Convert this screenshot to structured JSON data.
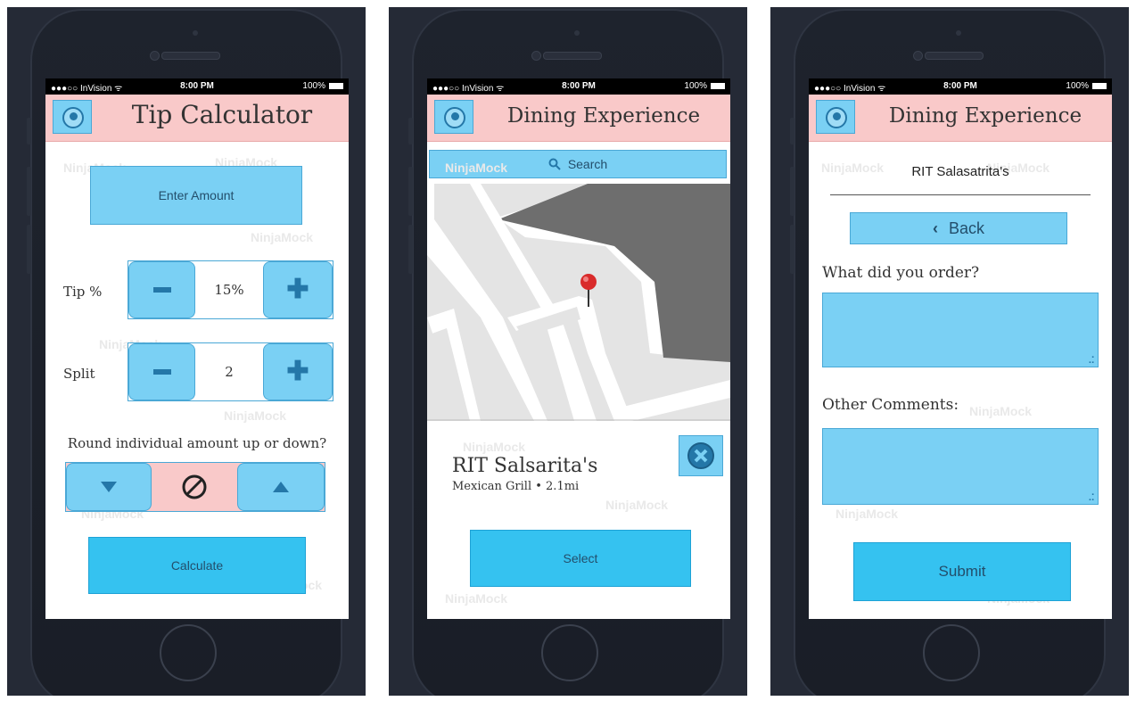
{
  "status_bar": {
    "carrier": "●●●○○ InVision ᯤ",
    "time": "8:00 PM",
    "battery": "100%"
  },
  "watermark": "NinjaMock",
  "screens": {
    "tip": {
      "title": "Tip Calculator",
      "enter_amount": "Enter Amount",
      "tip_label": "Tip %",
      "tip_value": "15%",
      "split_label": "Split",
      "split_value": "2",
      "round_label": "Round individual amount up or down?",
      "calculate": "Calculate"
    },
    "map": {
      "title": "Dining Experience",
      "search": "Search",
      "restaurant_name": "RIT Salsarita's",
      "restaurant_info": "Mexican Grill • 2.1mi",
      "select": "Select"
    },
    "review": {
      "title": "Dining Experience",
      "restaurant": "RIT Salasatrita's",
      "back": "Back",
      "order_label": "What did you order?",
      "comments_label": "Other Comments:",
      "submit": "Submit"
    }
  },
  "icons": {
    "back": "back-circle-icon",
    "minus": "minus-icon",
    "plus": "plus-icon",
    "down": "triangle-down-icon",
    "up": "triangle-up-icon",
    "none": "prohibited-icon",
    "search": "search-icon",
    "pin": "map-pin-icon",
    "close": "close-circle-icon",
    "chevron": "chevron-left-icon"
  },
  "colors": {
    "header": "#f9c9c9",
    "light_blue": "#7ad0f4",
    "button_blue": "#35c2f0",
    "device": "#1e232d"
  }
}
